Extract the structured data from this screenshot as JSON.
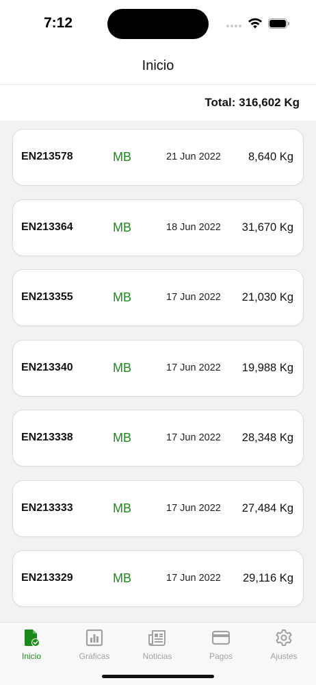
{
  "status_bar": {
    "time": "7:12"
  },
  "header": {
    "title": "Inicio"
  },
  "summary": {
    "total": "Total: 316,602 Kg"
  },
  "colors": {
    "accent": "#1a8a1a",
    "inactive": "#a0a0a0",
    "background": "#f2f2f5"
  },
  "entries": [
    {
      "code": "EN213578",
      "grade": "MB",
      "date": "21 Jun 2022",
      "weight": "8,640 Kg"
    },
    {
      "code": "EN213364",
      "grade": "MB",
      "date": "18 Jun 2022",
      "weight": "31,670 Kg"
    },
    {
      "code": "EN213355",
      "grade": "MB",
      "date": "17 Jun 2022",
      "weight": "21,030 Kg"
    },
    {
      "code": "EN213340",
      "grade": "MB",
      "date": "17 Jun 2022",
      "weight": "19,988 Kg"
    },
    {
      "code": "EN213338",
      "grade": "MB",
      "date": "17 Jun 2022",
      "weight": "28,348 Kg"
    },
    {
      "code": "EN213333",
      "grade": "MB",
      "date": "17 Jun 2022",
      "weight": "27,484 Kg"
    },
    {
      "code": "EN213329",
      "grade": "MB",
      "date": "17 Jun 2022",
      "weight": "29,116 Kg"
    }
  ],
  "tabs": [
    {
      "label": "Inicio",
      "icon": "document-check-icon",
      "active": true
    },
    {
      "label": "Gráficas",
      "icon": "bar-chart-icon",
      "active": false
    },
    {
      "label": "Noticias",
      "icon": "newspaper-icon",
      "active": false
    },
    {
      "label": "Pagos",
      "icon": "credit-card-icon",
      "active": false
    },
    {
      "label": "Ajustes",
      "icon": "gear-icon",
      "active": false
    }
  ]
}
